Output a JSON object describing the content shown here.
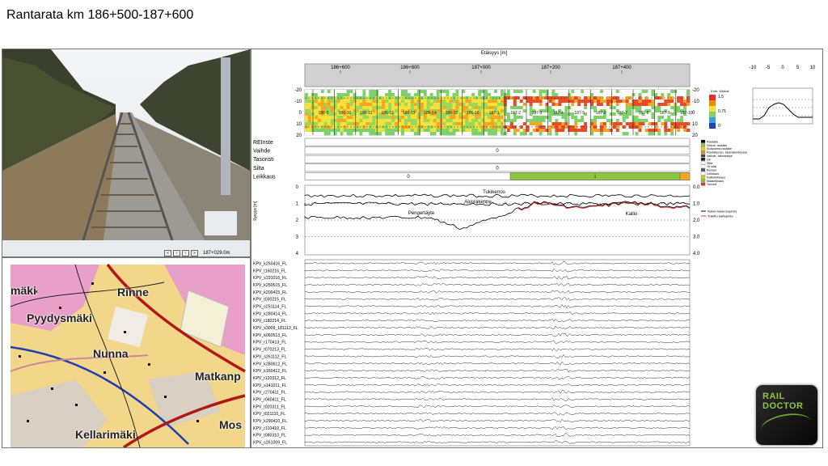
{
  "page_title": "Rantarata km 186+500-187+600",
  "photo": {
    "nav_buttons": [
      "«",
      "‹",
      "›",
      "»"
    ],
    "position": "187+029.0m"
  },
  "map": {
    "place_names": [
      "mäki",
      "Rinne",
      "Pyydysmäki",
      "Nunna",
      "Matkanp",
      "Mos",
      "Kellarimäki"
    ]
  },
  "distance_axis": {
    "title": "Etäisyys [m]",
    "ticks": [
      "186+600",
      "186+800",
      "187+000",
      "187+200",
      "187+400"
    ]
  },
  "gpr_panel": {
    "y_ticks_left": [
      "-20",
      "-10",
      "0",
      "10",
      "20"
    ],
    "y_ticks_right": [
      "-20",
      "-10",
      "0",
      "10",
      "20"
    ],
    "segment_labels": [
      "186-9",
      "186-10",
      "186-11",
      "186-12",
      "186-13",
      "186-14",
      "186-15",
      "186-16",
      "187-1",
      "187-2",
      "187-3",
      "187-4",
      "187-5",
      "187-6",
      "187-7",
      "187-8",
      "187-9",
      "187-10"
    ],
    "colorbar_title": "Kork. Kirkkai",
    "colorbar_ticks": [
      "1.5",
      "0.75",
      "0"
    ]
  },
  "inset_chart": {
    "ticks": [
      "-10",
      "-5",
      "0",
      "5",
      "10"
    ]
  },
  "track_rows": [
    {
      "label": "REInste",
      "value": "",
      "color": "#ffffff"
    },
    {
      "label": "Vaihde",
      "value": "0",
      "color": "#ffffff"
    },
    {
      "label": "Tasoristi",
      "value": "",
      "color": "#ffffff"
    },
    {
      "label": "Silta",
      "value": "0",
      "color": "#ffffff"
    },
    {
      "label": "Leikkaus",
      "value": "0",
      "color": "#ffffff"
    }
  ],
  "leikkaus_segment": {
    "label": "i",
    "color": "#8dc63f",
    "end_color": "#f5a623"
  },
  "legend_items": [
    {
      "label": "Rautatie",
      "color": "#000000"
    },
    {
      "label": "Sekoit. rautatie",
      "color": "#8dc63f"
    },
    {
      "label": "Epävarma rautatie",
      "color": "#f5c518"
    },
    {
      "label": "Rautatie/syv. alusrakenteessa",
      "color": "#f08c00"
    },
    {
      "label": "Vaihde, tasoristeys",
      "color": "#444444"
    },
    {
      "label": "Ok",
      "color": "#222222"
    },
    {
      "label": "Silta",
      "color": "#ffffff"
    },
    {
      "label": "Yli silta",
      "color": "#ffffff"
    },
    {
      "label": "Rumpu",
      "color": "#555555"
    },
    {
      "label": "Leikkaus",
      "color": "#ffffff"
    },
    {
      "label": "Kallioleikkaus",
      "color": "#e6c619"
    },
    {
      "label": "Maaleikkaus",
      "color": "#8dc63f"
    },
    {
      "label": "Tunneli",
      "color": "#e03030"
    }
  ],
  "layers_chart": {
    "y_ticks_left": [
      "0",
      "1",
      "2",
      "3",
      "4"
    ],
    "y_ticks_right": [
      "0.0",
      "1.0",
      "2.0",
      "3.0",
      "4.0"
    ],
    "y_label": "Syvyys [m]",
    "annotations": [
      "Tukikerros",
      "Alusrakenne",
      "Pengertäyte",
      "Kallio"
    ],
    "legend": [
      {
        "label": "Rakennekerrospinta",
        "color": "#000000"
      },
      {
        "label": "Tulkittu kalliopinta",
        "color": "#e03030"
      }
    ]
  },
  "trace_labels": [
    "KPV_k250416_FL",
    "KPV_t160216_FL",
    "KPV_s191016_FL",
    "KPV_k250515_FL",
    "KPV_k200415_FL",
    "KPV_t030215_FL",
    "KPV_s251114_FL",
    "KPV_k280414_FL",
    "KPV_t180214_FL",
    "KPV_s3009_181113_FL",
    "KPV_k060513_FL",
    "KPV_r170413_FL",
    "KPV_t070213_FL",
    "KPV_s261112_FL",
    "KPV_k280612_FL",
    "KPV_k160412_FL",
    "KPV_t120312_FL",
    "KPV_s141011_FL",
    "KPV_r270411_FL",
    "KPV_r040411_FL",
    "KPV_t020311_FL",
    "KPV_t021110_FL",
    "KPV_k290410_FL",
    "KPV_r110410_FL",
    "KPV_t080310_FL",
    "KPV_s261009_FL"
  ],
  "logo": {
    "line1": "RAIL",
    "line2": "DOCTOR"
  }
}
